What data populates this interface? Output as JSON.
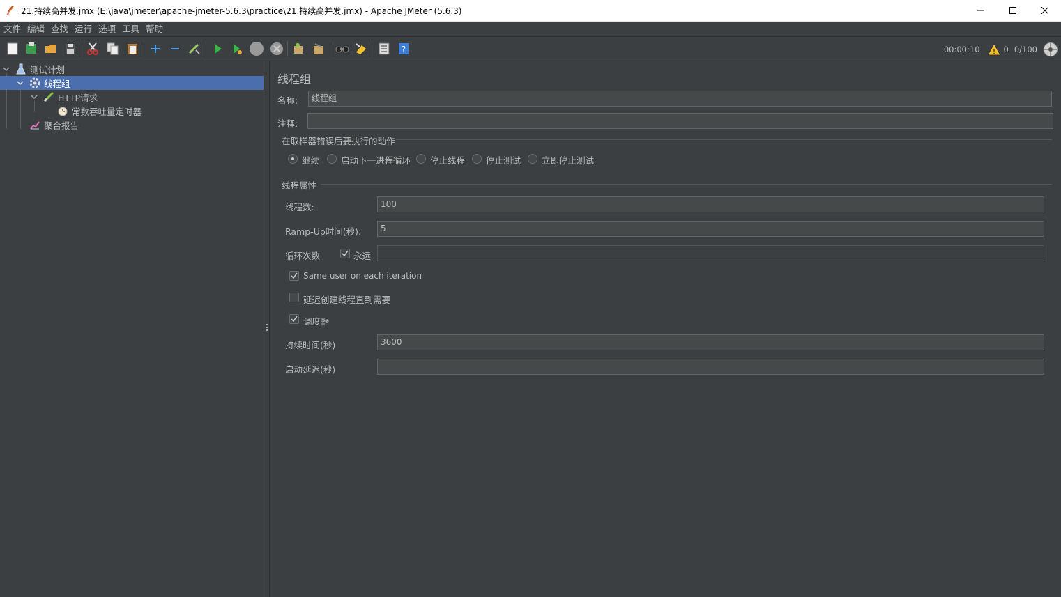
{
  "window": {
    "title": "21.持续高并发.jmx (E:\\java\\jmeter\\apache-jmeter-5.6.3\\practice\\21.持续高并发.jmx) - Apache JMeter (5.6.3)"
  },
  "menu": [
    "文件",
    "编辑",
    "查找",
    "运行",
    "选项",
    "工具",
    "帮助"
  ],
  "toolbar": {
    "buttons": [
      "new-icon",
      "templates-icon",
      "open-icon",
      "save-icon",
      "cut-icon",
      "copy-icon",
      "paste-icon",
      "expand-icon",
      "collapse-icon",
      "toggle-icon",
      "start-icon",
      "start-no-pause-icon",
      "stop-icon",
      "shutdown-icon",
      "clear-icon",
      "clear-all-icon",
      "search-icon",
      "reset-search-icon",
      "function-helper-icon",
      "help-icon"
    ],
    "elapsed_time": "00:00:10",
    "warning_count": "0",
    "thread_count": "0/100"
  },
  "tree": {
    "items": [
      {
        "label": "测试计划",
        "icon": "test-plan-icon"
      },
      {
        "label": "线程组",
        "icon": "thread-group-icon"
      },
      {
        "label": "HTTP请求",
        "icon": "http-sampler-icon"
      },
      {
        "label": "常数吞吐量定时器",
        "icon": "timer-icon"
      },
      {
        "label": "聚合报告",
        "icon": "report-icon"
      }
    ]
  },
  "panel": {
    "title": "线程组",
    "name_label": "名称:",
    "name_value": "线程组",
    "comment_label": "注释:",
    "comment_value": "",
    "error_section_title": "在取样器错误后要执行的动作",
    "error_actions": [
      {
        "label": "继续",
        "checked": true
      },
      {
        "label": "启动下一进程循环",
        "checked": false
      },
      {
        "label": "停止线程",
        "checked": false
      },
      {
        "label": "停止测试",
        "checked": false
      },
      {
        "label": "立即停止测试",
        "checked": false
      }
    ],
    "thread_section_title": "线程属性",
    "threads_label": "线程数:",
    "threads_value": "100",
    "rampup_label": "Ramp-Up时间(秒):",
    "rampup_value": "5",
    "loop_label": "循环次数",
    "forever_label": "永远",
    "forever_checked": true,
    "loop_value": "",
    "same_user_label": "Same user on each iteration",
    "same_user_checked": true,
    "delay_create_label": "延迟创建线程直到需要",
    "delay_create_checked": false,
    "scheduler_label": "调度器",
    "scheduler_checked": true,
    "duration_label": "持续时间(秒)",
    "duration_value": "3600",
    "startup_delay_label": "启动延迟(秒)",
    "startup_delay_value": ""
  }
}
